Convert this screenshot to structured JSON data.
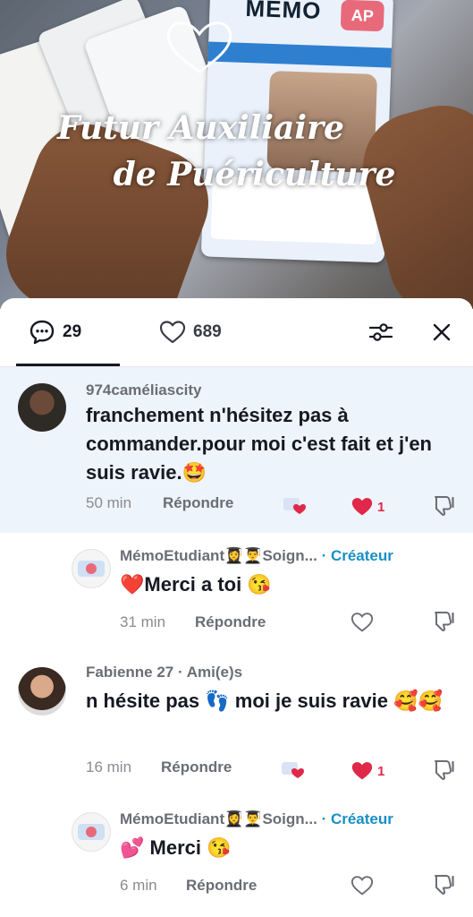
{
  "video": {
    "overlay_line1": "Futur Auxiliaire",
    "overlay_line2": "de Puériculture",
    "card_brand": "MÉMO",
    "card_badge": "AP"
  },
  "tabs": {
    "comments_count": "29",
    "likes_count": "689"
  },
  "icons": {
    "comment": "comment-bubble-icon",
    "heart": "heart-icon",
    "filter": "sliders-icon",
    "close": "close-icon",
    "dislike": "thumbs-down-icon"
  },
  "colors": {
    "highlight_bg": "#eef4fb",
    "like_red": "#e0284a",
    "creator_blue": "#188fc4"
  },
  "comments": [
    {
      "user": "974caméliascity",
      "text": "franchement n'hésitez pas à commander.pour moi c'est fait et j'en suis ravie.🤩",
      "time": "50 min",
      "reply": "Répondre",
      "likes": "1"
    },
    {
      "user": "MémoEtudiant👩‍🎓👨‍🎓Soign...",
      "badge": "· Créateur",
      "text": "❤️Merci a toi 😘",
      "time": "31 min",
      "reply": "Répondre"
    },
    {
      "user": "Fabienne 27",
      "badge": "· Ami(e)s",
      "text": "n hésite pas 👣 moi je suis ravie 🥰🥰",
      "time": "16 min",
      "reply": "Répondre",
      "likes": "1"
    },
    {
      "user": "MémoEtudiant👩‍🎓👨‍🎓Soign...",
      "badge": "· Créateur",
      "text": "💕 Merci 😘",
      "time": "6 min",
      "reply": "Répondre"
    }
  ]
}
